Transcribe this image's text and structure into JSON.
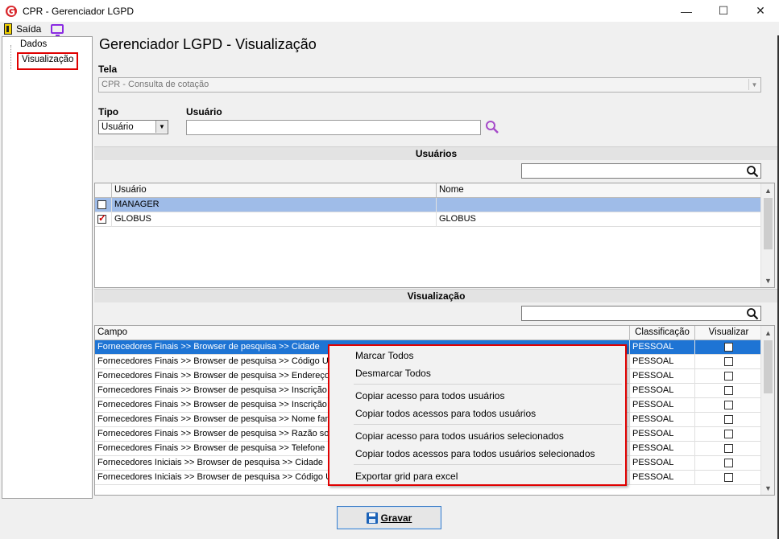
{
  "window": {
    "title": "CPR - Gerenciador LGPD",
    "minimize": "—",
    "maximize": "☐",
    "close": "✕"
  },
  "menu": {
    "exit_label": "Saída"
  },
  "tree": {
    "items": [
      {
        "label": "Dados"
      },
      {
        "label": "Visualização"
      }
    ]
  },
  "page": {
    "title": "Gerenciador LGPD - Visualização"
  },
  "form": {
    "tela_label": "Tela",
    "tela_value": "CPR - Consulta de cotação",
    "tipo_label": "Tipo",
    "tipo_value": "Usuário",
    "usuario_label": "Usuário",
    "usuario_value": ""
  },
  "usuarios": {
    "header": "Usuários",
    "search_value": "",
    "columns": [
      "Usuário",
      "Nome"
    ],
    "rows": [
      {
        "checked": false,
        "usuario": "MANAGER",
        "nome": ""
      },
      {
        "checked": true,
        "usuario": "GLOBUS",
        "nome": "GLOBUS"
      }
    ]
  },
  "visualizacao": {
    "header": "Visualização",
    "search_value": "",
    "columns": [
      "Campo",
      "Classificação",
      "Visualizar"
    ],
    "rows": [
      {
        "campo": "Fornecedores Finais >> Browser de pesquisa >> Cidade",
        "classificacao": "PESSOAL",
        "visualizar": false
      },
      {
        "campo": "Fornecedores Finais >> Browser de pesquisa >> Código UF",
        "classificacao": "PESSOAL",
        "visualizar": false
      },
      {
        "campo": "Fornecedores Finais >> Browser de pesquisa >> Endereço",
        "classificacao": "PESSOAL",
        "visualizar": false
      },
      {
        "campo": "Fornecedores Finais >> Browser de pesquisa >> Inscrição",
        "classificacao": "PESSOAL",
        "visualizar": false
      },
      {
        "campo": "Fornecedores Finais >> Browser de pesquisa >> Inscrição es",
        "classificacao": "PESSOAL",
        "visualizar": false
      },
      {
        "campo": "Fornecedores Finais >> Browser de pesquisa >> Nome fanta",
        "classificacao": "PESSOAL",
        "visualizar": false
      },
      {
        "campo": "Fornecedores Finais >> Browser de pesquisa >> Razão socia",
        "classificacao": "PESSOAL",
        "visualizar": false
      },
      {
        "campo": "Fornecedores Finais >> Browser de pesquisa >> Telefone",
        "classificacao": "PESSOAL",
        "visualizar": false
      },
      {
        "campo": "Fornecedores Iniciais >> Browser de pesquisa >> Cidade",
        "classificacao": "PESSOAL",
        "visualizar": false
      },
      {
        "campo": "Fornecedores Iniciais >> Browser de pesquisa >> Código UF",
        "classificacao": "PESSOAL",
        "visualizar": false
      }
    ]
  },
  "context_menu": {
    "items": [
      "Marcar Todos",
      "Desmarcar Todos",
      "Copiar acesso para todos usuários",
      "Copiar todos acessos para todos usuários",
      "Copiar acesso para todos usuários selecionados",
      "Copiar todos acessos para todos usuários selecionados",
      "Exportar grid para excel"
    ]
  },
  "footer": {
    "save_label": "Gravar"
  },
  "colors": {
    "selection_row": "#1e74d4",
    "highlight_row": "#9fbce8",
    "annotation_red": "#e00000",
    "app_icon_red": "#d8262b"
  }
}
